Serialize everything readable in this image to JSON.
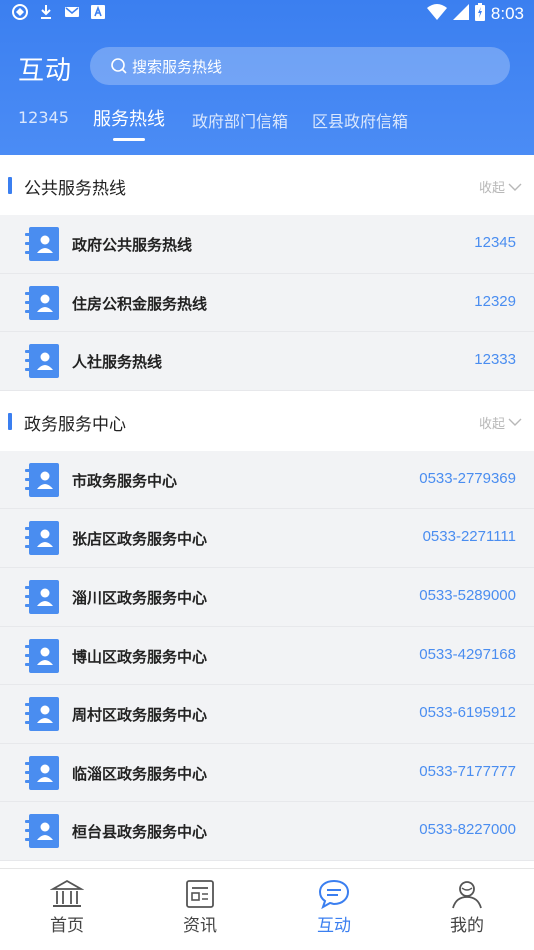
{
  "status_bar": {
    "time": "8:03"
  },
  "header": {
    "title": "互动",
    "search_placeholder": "搜索服务热线",
    "tabs": [
      {
        "label": "12345",
        "active": false
      },
      {
        "label": "服务热线",
        "active": true
      },
      {
        "label": "政府部门信箱",
        "active": false
      },
      {
        "label": "区县政府信箱",
        "active": false
      }
    ]
  },
  "sections": [
    {
      "title": "公共服务热线",
      "collapse_label": "收起",
      "items": [
        {
          "name": "政府公共服务热线",
          "phone": "12345"
        },
        {
          "name": "住房公积金服务热线",
          "phone": "12329"
        },
        {
          "name": "人社服务热线",
          "phone": "12333"
        }
      ]
    },
    {
      "title": "政务服务中心",
      "collapse_label": "收起",
      "items": [
        {
          "name": "市政务服务中心",
          "phone": "0533-2779369"
        },
        {
          "name": "张店区政务服务中心",
          "phone": "0533-2271111"
        },
        {
          "name": "淄川区政务服务中心",
          "phone": "0533-5289000"
        },
        {
          "name": "博山区政务服务中心",
          "phone": "0533-4297168"
        },
        {
          "name": "周村区政务服务中心",
          "phone": "0533-6195912"
        },
        {
          "name": "临淄区政务服务中心",
          "phone": "0533-7177777"
        },
        {
          "name": "桓台县政务服务中心",
          "phone": "0533-8227000"
        }
      ]
    }
  ],
  "bottom_nav": [
    {
      "label": "首页",
      "icon": "home-icon",
      "active": false
    },
    {
      "label": "资讯",
      "icon": "news-icon",
      "active": false
    },
    {
      "label": "互动",
      "icon": "chat-icon",
      "active": true
    },
    {
      "label": "我的",
      "icon": "profile-icon",
      "active": false
    }
  ],
  "colors": {
    "primary": "#3b7ff0",
    "phone": "#4a8df0",
    "list_bg": "#f2f3f5"
  }
}
